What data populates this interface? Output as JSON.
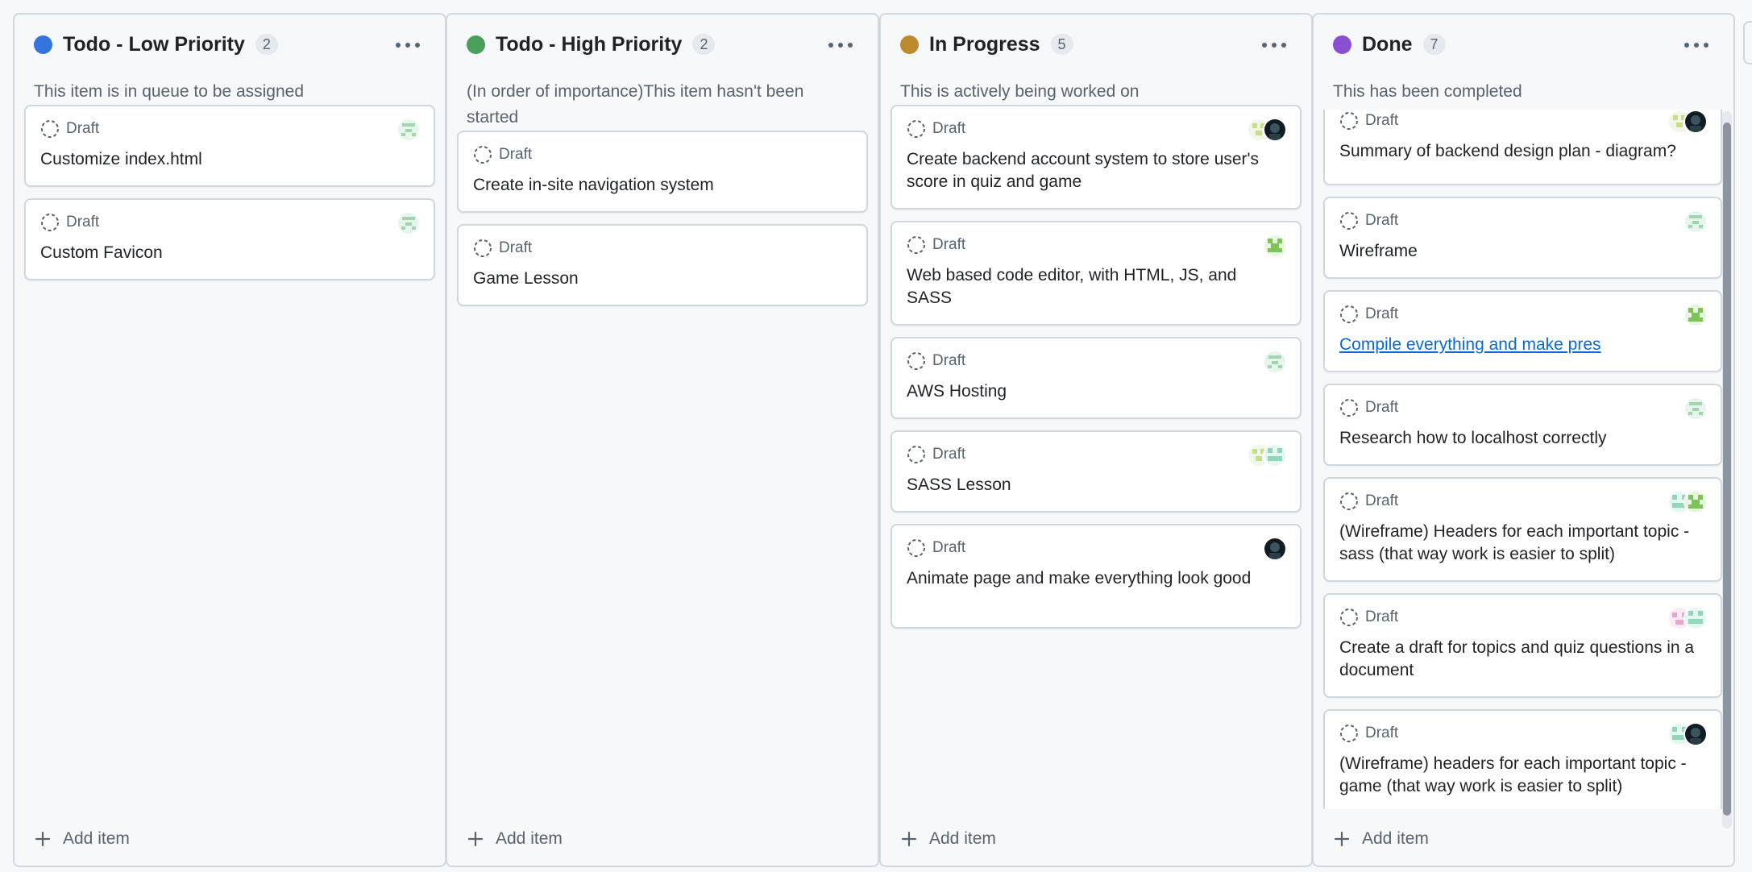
{
  "columns": [
    {
      "title": "Todo - Low Priority",
      "count": "2",
      "color": "#3275dd",
      "description": "This item is in queue to be assigned",
      "add_label": "Add item",
      "cards": [
        {
          "status": "Draft",
          "title": "Customize index.html",
          "avatars": [
            "identicon-green"
          ]
        },
        {
          "status": "Draft",
          "title": "Custom Favicon",
          "avatars": [
            "identicon-green"
          ]
        }
      ]
    },
    {
      "title": "Todo - High Priority",
      "count": "2",
      "color": "#4aa05a",
      "description": "(In order of importance)This item hasn't been started",
      "add_label": "Add item",
      "cards": [
        {
          "status": "Draft",
          "title": "Create in-site navigation system",
          "avatars": []
        },
        {
          "status": "Draft",
          "title": "Game Lesson",
          "avatars": []
        }
      ]
    },
    {
      "title": "In Progress",
      "count": "5",
      "color": "#bf8a2d",
      "description": "This is actively being worked on",
      "add_label": "Add item",
      "cards": [
        {
          "status": "Draft",
          "title": "Create backend account system to store user's score in quiz and game",
          "avatars": [
            "photo-dark",
            "identicon-olive"
          ]
        },
        {
          "status": "Draft",
          "title": "Web based code editor, with HTML, JS, and SASS",
          "avatars": [
            "identicon-lime"
          ]
        },
        {
          "status": "Draft",
          "title": "AWS Hosting",
          "avatars": [
            "identicon-green"
          ]
        },
        {
          "status": "Draft",
          "title": "SASS Lesson",
          "avatars": [
            "identicon-mint",
            "identicon-olive"
          ]
        },
        {
          "status": "Draft",
          "title": "Animate page and make everything look good",
          "avatars": [
            "photo-dark"
          ]
        }
      ]
    },
    {
      "title": "Done",
      "count": "7",
      "color": "#8a4fd1",
      "description": "This has been completed",
      "add_label": "Add item",
      "cards": [
        {
          "status": "Draft",
          "title": "Summary of backend design plan - diagram?",
          "avatars": [
            "photo-dark",
            "identicon-olive"
          ]
        },
        {
          "status": "Draft",
          "title": "Wireframe",
          "avatars": [
            "identicon-green"
          ]
        },
        {
          "status": "Draft",
          "title": "Compile everything and make pres",
          "avatars": [
            "identicon-lime"
          ],
          "link": true
        },
        {
          "status": "Draft",
          "title": "Research how to localhost correctly",
          "avatars": [
            "identicon-green"
          ]
        },
        {
          "status": "Draft",
          "title": "(Wireframe) Headers for each important topic - sass (that way work is easier to split)",
          "avatars": [
            "identicon-lime",
            "identicon-mint"
          ]
        },
        {
          "status": "Draft",
          "title": "Create a draft for topics and quiz questions in a document",
          "avatars": [
            "identicon-mint",
            "identicon-pink"
          ]
        },
        {
          "status": "Draft",
          "title": "(Wireframe) headers for each important topic - game (that way work is easier to split)",
          "avatars": [
            "photo-dark",
            "identicon-mint"
          ]
        }
      ]
    }
  ]
}
